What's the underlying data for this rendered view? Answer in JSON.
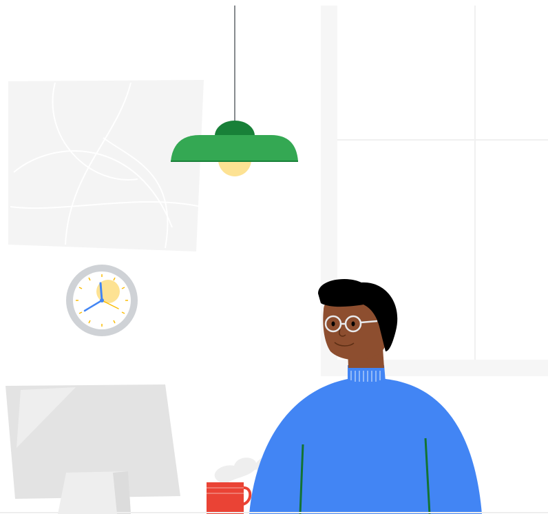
{
  "illustration": {
    "colors": {
      "background": "#ffffff",
      "wall_panel": "#f5f5f5",
      "window_frame": "#f3f3f3",
      "lamp_shade": "#34a853",
      "lamp_cap": "#188038",
      "lamp_bulb": "#fde293",
      "clock_rim": "#cfd2d6",
      "clock_face": "#ffffff",
      "clock_hands": "#4285f4",
      "clock_accent": "#fde293",
      "skin": "#8d4e2f",
      "hair": "#000000",
      "glasses": "#e8eaed",
      "sweater": "#4285f4",
      "sweater_seams": "#137333",
      "monitor": "#e3e3e3",
      "mug": "#ea4335",
      "steam": "#eeeeee"
    },
    "icons": [
      "pendant-lamp-icon",
      "wall-clock-icon",
      "framed-art-icon",
      "window-icon",
      "monitor-icon",
      "coffee-mug-icon",
      "person-avatar-icon"
    ]
  }
}
